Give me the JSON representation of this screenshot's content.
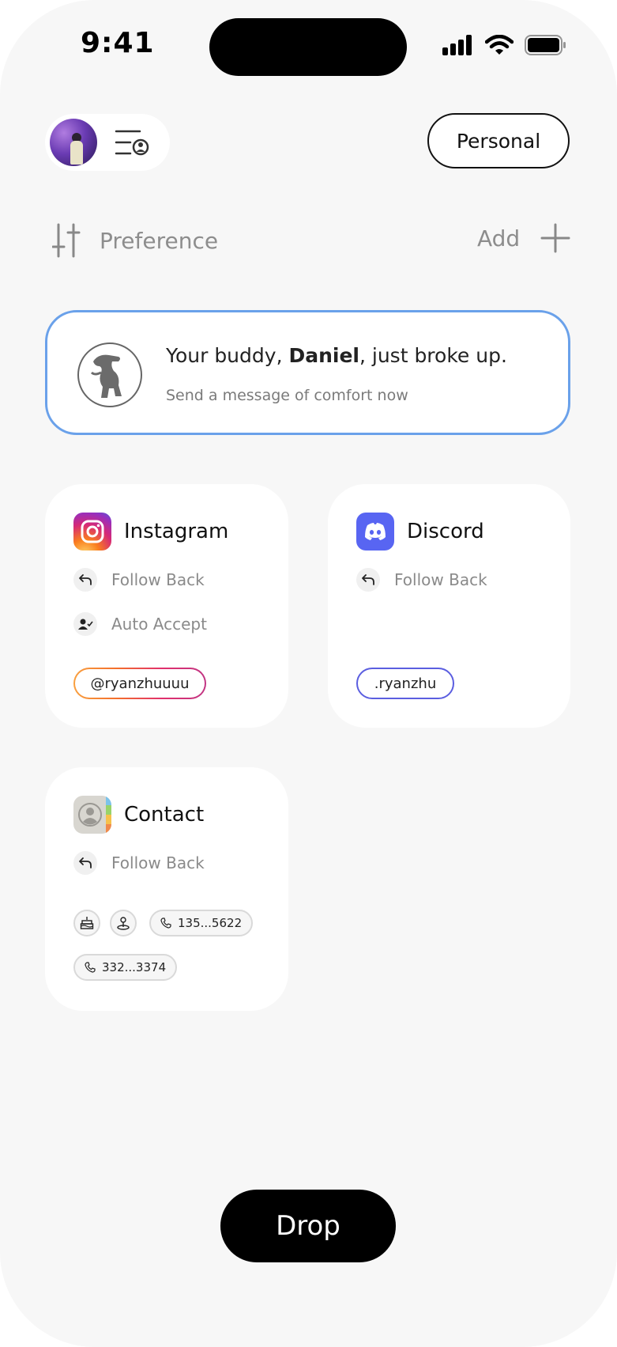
{
  "status_bar": {
    "time": "9:41"
  },
  "header": {
    "mode_button": "Personal"
  },
  "toolbar": {
    "preference_label": "Preference",
    "add_label": "Add"
  },
  "notice": {
    "title_prefix": "Your buddy, ",
    "title_name": "Daniel",
    "title_suffix": ", just broke up.",
    "subtitle": "Send a message of comfort now"
  },
  "cards": {
    "instagram": {
      "title": "Instagram",
      "actions": [
        "Follow Back",
        "Auto Accept"
      ],
      "handle": "@ryanzhuuuu"
    },
    "discord": {
      "title": "Discord",
      "actions": [
        "Follow Back"
      ],
      "handle": ".ryanzhu"
    },
    "contact": {
      "title": "Contact",
      "actions": [
        "Follow Back"
      ],
      "phones": [
        "135...5622",
        "332...3374"
      ]
    }
  },
  "drop_button": "Drop",
  "colors": {
    "accent_border": "#6aa1ea",
    "discord": "#5865f2"
  }
}
